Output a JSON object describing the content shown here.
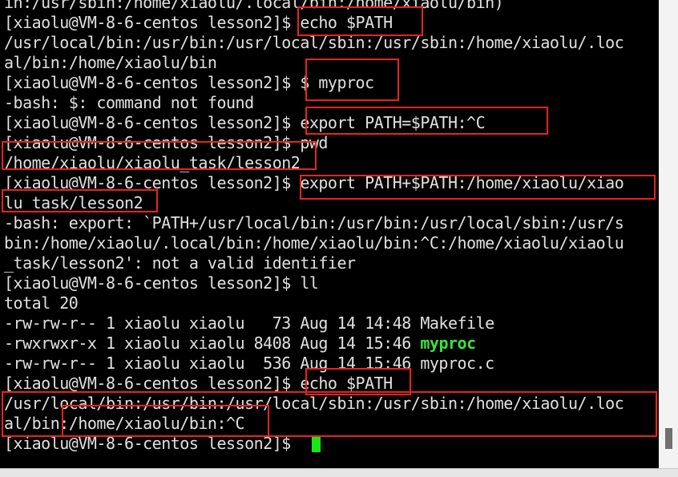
{
  "colors": {
    "background": "#000000",
    "text": "#e0e0e0",
    "highlight_box": "#e8231f",
    "exec_green": "#3ce23c",
    "cursor": "#19e619"
  },
  "lines": [
    "in:/usr/sbin:/home/xiaolu/.local/bin:/home/xiaolu/bin)",
    "[xiaolu@VM-8-6-centos lesson2]$ echo $PATH",
    "/usr/local/bin:/usr/bin:/usr/local/sbin:/usr/sbin:/home/xiaolu/.loc",
    "al/bin:/home/xiaolu/bin",
    "[xiaolu@VM-8-6-centos lesson2]$ $ myproc",
    "-bash: $: command not found",
    "[xiaolu@VM-8-6-centos lesson2]$ export PATH=$PATH:^C",
    "[xiaolu@VM-8-6-centos lesson2]$ pwd",
    "/home/xiaolu/xiaolu_task/lesson2",
    "[xiaolu@VM-8-6-centos lesson2]$ export PATH+$PATH:/home/xiaolu/xiao",
    "lu_task/lesson2",
    "-bash: export: `PATH+/usr/local/bin:/usr/bin:/usr/local/sbin:/usr/s",
    "bin:/home/xiaolu/.local/bin:/home/xiaolu/bin:^C:/home/xiaolu/xiaolu",
    "_task/lesson2': not a valid identifier",
    "[xiaolu@VM-8-6-centos lesson2]$ ll",
    "total 20",
    "-rw-rw-r-- 1 xiaolu xiaolu   73 Aug 14 14:48 Makefile",
    "-rwxrwxr-x 1 xiaolu xiaolu 8408 Aug 14 15:46 ",
    "-rw-rw-r-- 1 xiaolu xiaolu  536 Aug 14 15:46 myproc.c",
    "[xiaolu@VM-8-6-centos lesson2]$ echo $PATH",
    "/usr/local/bin:/usr/bin:/usr/local/sbin:/usr/sbin:/home/xiaolu/.loc",
    "al/bin:/home/xiaolu/bin:^C",
    "[xiaolu@VM-8-6-centos lesson2]$ "
  ],
  "executable_name": "myproc"
}
